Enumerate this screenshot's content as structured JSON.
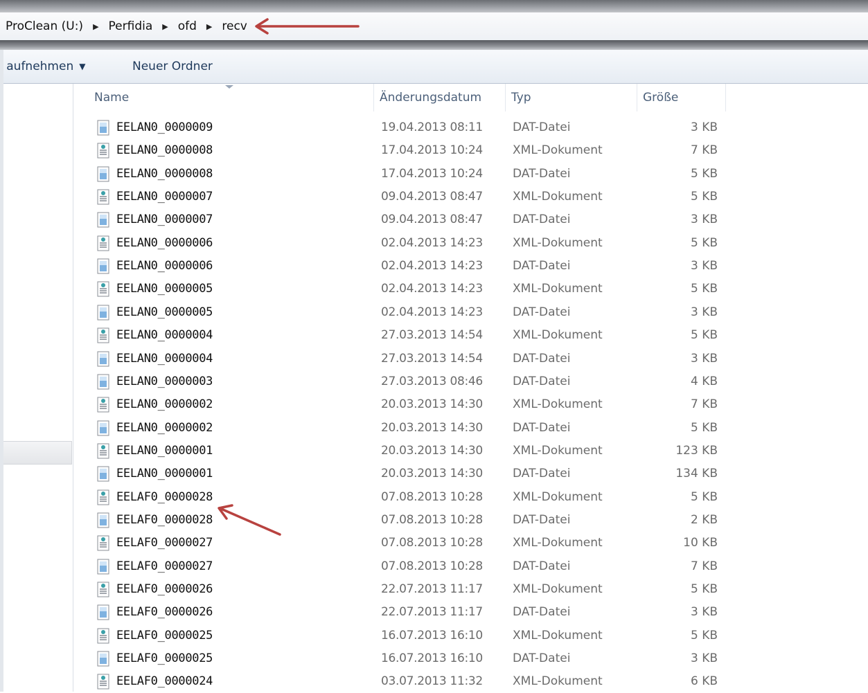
{
  "breadcrumb": [
    "ProClean (U:)",
    "Perfidia",
    "ofd",
    "recv"
  ],
  "toolbar": {
    "include_library": "k aufnehmen",
    "new_folder": "Neuer Ordner"
  },
  "columns": {
    "name": "Name",
    "date": "Änderungsdatum",
    "type": "Typ",
    "size": "Größe"
  },
  "files": [
    {
      "name": "EELAN0_0000009",
      "date": "19.04.2013 08:11",
      "type": "DAT-Datei",
      "size": "3 KB",
      "icon": "dat-file-icon"
    },
    {
      "name": "EELAN0_0000008",
      "date": "17.04.2013 10:24",
      "type": "XML-Dokument",
      "size": "7 KB",
      "icon": "xml-file-icon"
    },
    {
      "name": "EELAN0_0000008",
      "date": "17.04.2013 10:24",
      "type": "DAT-Datei",
      "size": "5 KB",
      "icon": "dat-file-icon"
    },
    {
      "name": "EELAN0_0000007",
      "date": "09.04.2013 08:47",
      "type": "XML-Dokument",
      "size": "5 KB",
      "icon": "xml-file-icon"
    },
    {
      "name": "EELAN0_0000007",
      "date": "09.04.2013 08:47",
      "type": "DAT-Datei",
      "size": "3 KB",
      "icon": "dat-file-icon"
    },
    {
      "name": "EELAN0_0000006",
      "date": "02.04.2013 14:23",
      "type": "XML-Dokument",
      "size": "5 KB",
      "icon": "xml-file-icon"
    },
    {
      "name": "EELAN0_0000006",
      "date": "02.04.2013 14:23",
      "type": "DAT-Datei",
      "size": "3 KB",
      "icon": "dat-file-icon"
    },
    {
      "name": "EELAN0_0000005",
      "date": "02.04.2013 14:23",
      "type": "XML-Dokument",
      "size": "5 KB",
      "icon": "xml-file-icon"
    },
    {
      "name": "EELAN0_0000005",
      "date": "02.04.2013 14:23",
      "type": "DAT-Datei",
      "size": "3 KB",
      "icon": "dat-file-icon"
    },
    {
      "name": "EELAN0_0000004",
      "date": "27.03.2013 14:54",
      "type": "XML-Dokument",
      "size": "5 KB",
      "icon": "xml-file-icon"
    },
    {
      "name": "EELAN0_0000004",
      "date": "27.03.2013 14:54",
      "type": "DAT-Datei",
      "size": "3 KB",
      "icon": "dat-file-icon"
    },
    {
      "name": "EELAN0_0000003",
      "date": "27.03.2013 08:46",
      "type": "DAT-Datei",
      "size": "4 KB",
      "icon": "dat-file-icon"
    },
    {
      "name": "EELAN0_0000002",
      "date": "20.03.2013 14:30",
      "type": "XML-Dokument",
      "size": "7 KB",
      "icon": "xml-file-icon"
    },
    {
      "name": "EELAN0_0000002",
      "date": "20.03.2013 14:30",
      "type": "DAT-Datei",
      "size": "5 KB",
      "icon": "dat-file-icon"
    },
    {
      "name": "EELAN0_0000001",
      "date": "20.03.2013 14:30",
      "type": "XML-Dokument",
      "size": "123 KB",
      "icon": "xml-file-icon"
    },
    {
      "name": "EELAN0_0000001",
      "date": "20.03.2013 14:30",
      "type": "DAT-Datei",
      "size": "134 KB",
      "icon": "dat-file-icon"
    },
    {
      "name": "EELAF0_0000028",
      "date": "07.08.2013 10:28",
      "type": "XML-Dokument",
      "size": "5 KB",
      "icon": "xml-file-icon"
    },
    {
      "name": "EELAF0_0000028",
      "date": "07.08.2013 10:28",
      "type": "DAT-Datei",
      "size": "2 KB",
      "icon": "dat-file-icon"
    },
    {
      "name": "EELAF0_0000027",
      "date": "07.08.2013 10:28",
      "type": "XML-Dokument",
      "size": "10 KB",
      "icon": "xml-file-icon"
    },
    {
      "name": "EELAF0_0000027",
      "date": "07.08.2013 10:28",
      "type": "DAT-Datei",
      "size": "7 KB",
      "icon": "dat-file-icon"
    },
    {
      "name": "EELAF0_0000026",
      "date": "22.07.2013 11:17",
      "type": "XML-Dokument",
      "size": "5 KB",
      "icon": "xml-file-icon"
    },
    {
      "name": "EELAF0_0000026",
      "date": "22.07.2013 11:17",
      "type": "DAT-Datei",
      "size": "3 KB",
      "icon": "dat-file-icon"
    },
    {
      "name": "EELAF0_0000025",
      "date": "16.07.2013 16:10",
      "type": "XML-Dokument",
      "size": "5 KB",
      "icon": "xml-file-icon"
    },
    {
      "name": "EELAF0_0000025",
      "date": "16.07.2013 16:10",
      "type": "DAT-Datei",
      "size": "3 KB",
      "icon": "dat-file-icon"
    },
    {
      "name": "EELAF0_0000024",
      "date": "03.07.2013 11:32",
      "type": "XML-Dokument",
      "size": "6 KB",
      "icon": "xml-file-icon"
    }
  ],
  "colors": {
    "annotation_arrow": "#b8423f",
    "header_text": "#4c607a",
    "toolbar_text": "#1e395b"
  }
}
